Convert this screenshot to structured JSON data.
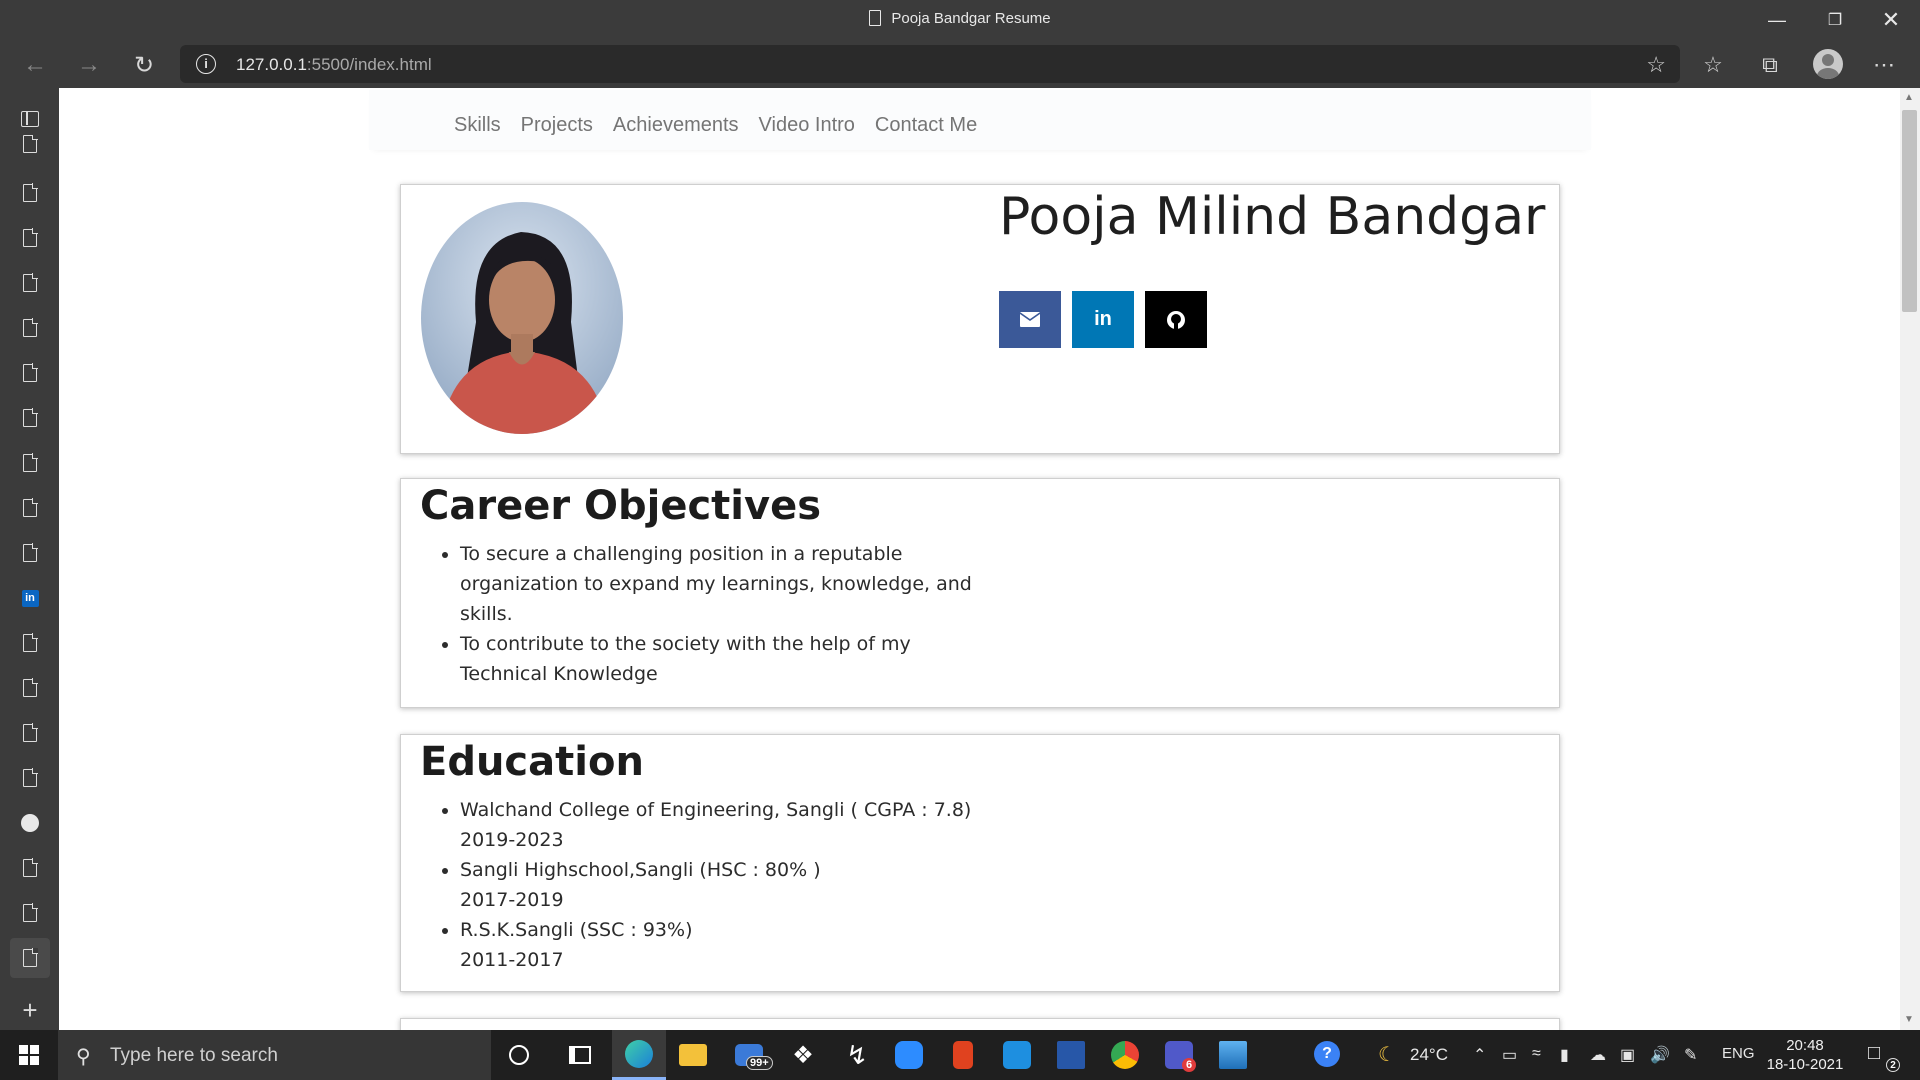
{
  "window": {
    "title": "Pooja Bandgar Resume"
  },
  "browser": {
    "url_host": "127.0.0.1",
    "url_path": ":5500/index.html"
  },
  "site": {
    "nav": [
      "Skills",
      "Projects",
      "Achievements",
      "Video Intro",
      "Contact Me"
    ],
    "name": "Pooja Milind Bandgar",
    "social": [
      {
        "icon": "mail-icon",
        "color": "#3b5998"
      },
      {
        "icon": "linkedin-icon",
        "color": "#0077b5"
      },
      {
        "icon": "github-icon",
        "color": "#000000"
      }
    ],
    "career": {
      "title": "Career Objectives",
      "items": [
        "To secure a challenging position in a reputable organization to expand my learnings, knowledge, and skills.",
        "To contribute to the society with the help of my Technical Knowledge"
      ]
    },
    "education": {
      "title": "Education",
      "items": [
        {
          "school": "Walchand College of Engineering, Sangli ( CGPA : 7.8)",
          "years": "2019-2023"
        },
        {
          "school": "Sangli Highschool,Sangli (HSC : 80% )",
          "years": "2017-2019"
        },
        {
          "school": "R.S.K.Sangli (SSC : 93%)",
          "years": "2011-2017"
        }
      ]
    }
  },
  "taskbar": {
    "search_placeholder": "Type here to search",
    "mail_badge": "99+",
    "teams_badge": "6",
    "weather": "24°C",
    "language": "ENG",
    "time": "20:48",
    "date": "18-10-2021",
    "notifications": "2"
  }
}
